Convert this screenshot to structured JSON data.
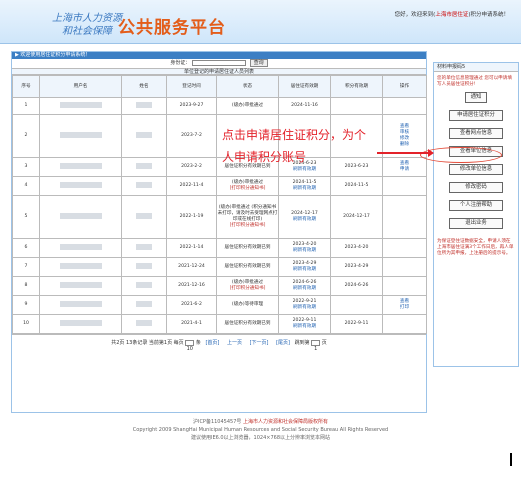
{
  "header": {
    "logo_line1": "上海市人力资源",
    "logo_line2": "和社会保障",
    "logo_main": "公共服务平台",
    "welcome_prefix": "您好，欢迎来到",
    "welcome_link": "上海市居住证",
    "welcome_suffix": "积分申请系统！"
  },
  "breadcrumb": "▶ 欢迎使用居住证积分申请系统！",
  "filter": {
    "label": "身份证：",
    "query_button": "查询"
  },
  "list_title": "单位登记的申请居住证人员列表",
  "columns": [
    "序号",
    "用户名",
    "姓名",
    "登记时间",
    "状态",
    "居住证有效期",
    "积分有效期",
    "操作"
  ],
  "rows": [
    {
      "no": "1",
      "reg": "2023-9-27",
      "status": "(级办)审批通过",
      "res_valid": "2024-11-16",
      "pt_valid": "",
      "ops": ""
    },
    {
      "no": "2",
      "reg": "2023-7-2",
      "status": "",
      "res_valid": "",
      "pt_valid": "",
      "ops": "查看 审核 修改 删除"
    },
    {
      "no": "3",
      "reg": "2023-2-2",
      "status": "居住证积分有效期已到",
      "res_valid": "2024-6-23",
      "res_link": "刷新有效期",
      "pt_valid": "2023-6-23",
      "ops": "查看 申请"
    },
    {
      "no": "4",
      "reg": "2022-11-4",
      "status": "(级办)审批通过",
      "status_link": "[打印积分通知书]",
      "res_valid": "2024-11-5",
      "res_link": "刷新有效期",
      "pt_valid": "2024-11-5",
      "ops": ""
    },
    {
      "no": "5",
      "reg": "2022-1-19",
      "status": "(级办)审批通过 (积分通知书未打印，请及时去受理网点打印或在线打印)",
      "status_link": "[打印积分通知书]",
      "res_valid": "2024-12-17",
      "res_link": "刷新有效期",
      "pt_valid": "2024-12-17",
      "ops": ""
    },
    {
      "no": "6",
      "reg": "2022-1-14",
      "status": "居住证积分有效期已到",
      "res_valid": "2023-4-20",
      "res_link": "刷新有效期",
      "pt_valid": "2023-4-20",
      "ops": ""
    },
    {
      "no": "7",
      "reg": "2021-12-24",
      "status": "居住证积分有效期已到",
      "res_valid": "2023-4-29",
      "res_link": "刷新有效期",
      "pt_valid": "2023-4-29",
      "ops": ""
    },
    {
      "no": "8",
      "reg": "2021-12-16",
      "status": "(级办)审批通过",
      "status_link": "[打印积分通知书]",
      "res_valid": "2024-6-26",
      "res_link": "刷新有效期",
      "pt_valid": "2024-6-26",
      "ops": ""
    },
    {
      "no": "9",
      "reg": "2021-6-2",
      "status": "(级办)等待审理",
      "res_valid": "2022-9-21",
      "res_link": "刷新有效期",
      "pt_valid": "",
      "ops": "查看 打印"
    },
    {
      "no": "10",
      "reg": "2021-4-1",
      "status": "居住证积分有效期已到",
      "res_valid": "2022-9-11",
      "res_link": "刷新有效期",
      "pt_valid": "2022-9-11",
      "ops": ""
    }
  ],
  "pager": {
    "summary": "共2页 13条记录 当前第1页 每页",
    "per_page": "10",
    "per_unit": "条",
    "first": "[首页]",
    "prev": "上一页",
    "next": "[下一页]",
    "last": "[尾页]",
    "jump": "跳到第",
    "jump_value": "1",
    "jump_unit": "页"
  },
  "side": {
    "head": "材料申报码5",
    "note": "您的单位信息管理通过 您可以申请填写人员居住证积分!",
    "buttons": [
      "通知",
      "申请居住证积分",
      "查看网点信息",
      "查看单位信息",
      "修改单位信息",
      "修改密码",
      "个人注册帮助",
      "退出业务"
    ],
    "warn": "为保证登住证数据安全，申请人须在上海市居住证满3个工作日后，再人单位所为其申报，上注册后的提示号。"
  },
  "annotation": {
    "line1": "点击申请居住证积分，为个",
    "line2": "人申请积分账号"
  },
  "footer": {
    "icp": "沪ICP备11045457号",
    "org": "上海市人力资源和社会保障局版权所有",
    "copyright": "Copyright 2009 ShangHai Municipal Human Resources and Social Security Bureau All Rights Reserved",
    "browser": "建议使用IE6.0以上浏览器，1024×768以上分辨率浏览本网站"
  },
  "colors": {
    "accent": "#e35d1a",
    "link": "#1d5fb0",
    "alert": "#c0302a",
    "annotation": "#e3222a"
  }
}
